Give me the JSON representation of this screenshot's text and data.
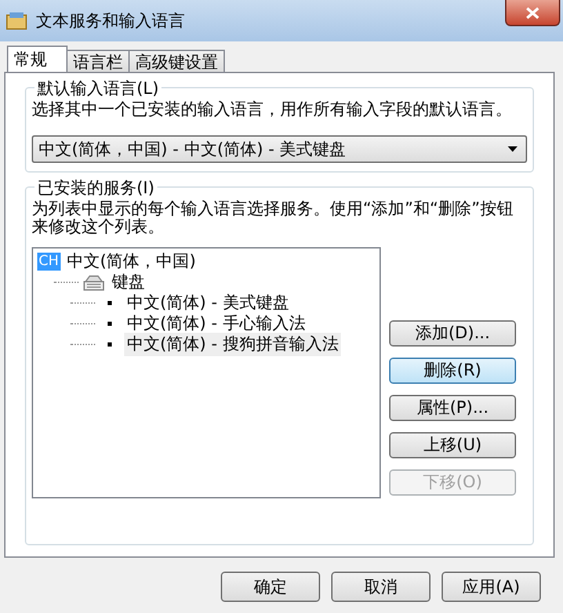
{
  "window": {
    "title": "文本服务和输入语言"
  },
  "tabs": [
    {
      "label": "常规",
      "selected": true
    },
    {
      "label": "语言栏",
      "selected": false
    },
    {
      "label": "高级键设置",
      "selected": false
    }
  ],
  "default_language": {
    "legend": "默认输入语言(L)",
    "description": "选择其中一个已安装的输入语言，用作所有输入字段的默认语言。",
    "dropdown": {
      "value": "中文(简体，中国) - 中文(简体) - 美式键盘"
    }
  },
  "installed_services": {
    "legend": "已安装的服务(I)",
    "description": "为列表中显示的每个输入语言选择服务。使用“添加”和“删除”按钮来修改这个列表。",
    "tree": [
      {
        "badge": "CH",
        "label": "中文(简体，中国)",
        "children": [
          {
            "label": "键盘",
            "children": [
              {
                "label": "中文(简体) - 美式键盘",
                "selected": false
              },
              {
                "label": "中文(简体) - 手心输入法",
                "selected": false
              },
              {
                "label": "中文(简体) - 搜狗拼音输入法",
                "selected": true
              }
            ]
          }
        ]
      }
    ],
    "buttons": [
      {
        "label": "添加(D)...",
        "focused": false,
        "disabled": false
      },
      {
        "label": "删除(R)",
        "focused": true,
        "disabled": false
      },
      {
        "label": "属性(P)...",
        "focused": false,
        "disabled": false
      },
      {
        "label": "上移(U)",
        "focused": false,
        "disabled": false
      },
      {
        "label": "下移(O)",
        "focused": false,
        "disabled": true
      }
    ]
  },
  "dialog_buttons": [
    {
      "label": "确定"
    },
    {
      "label": "取消"
    },
    {
      "label": "应用(A)"
    }
  ]
}
